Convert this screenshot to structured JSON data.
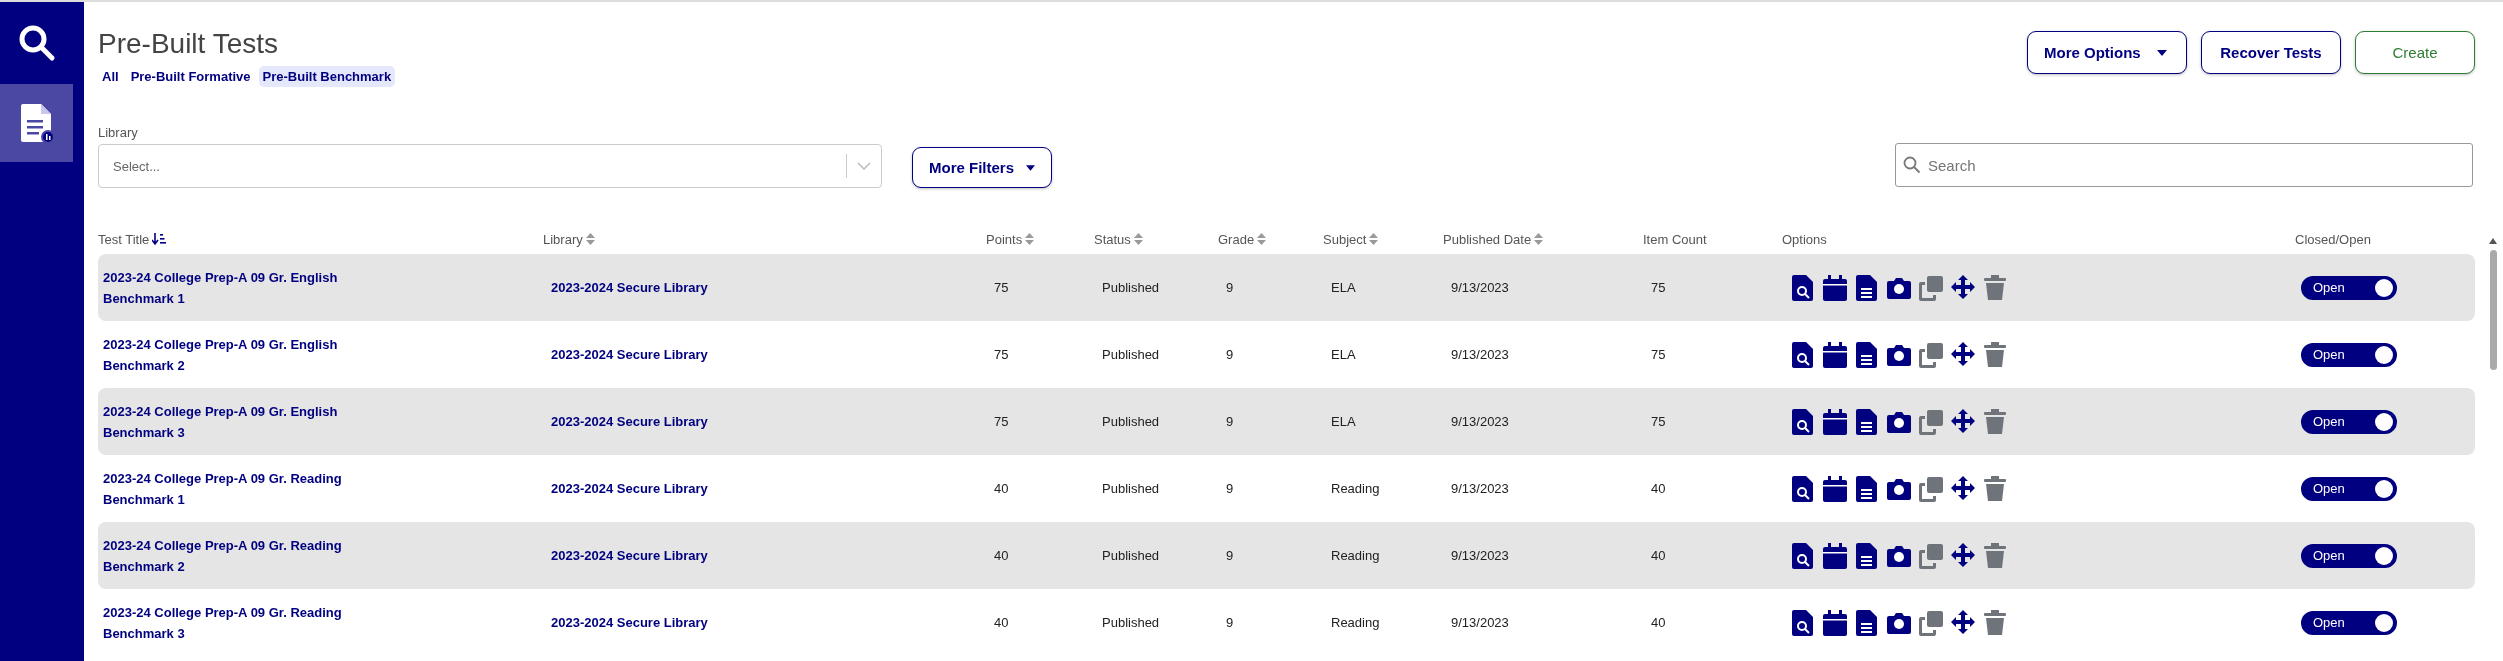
{
  "sidebar": {
    "items": [
      {
        "kind": "search",
        "selected": false
      },
      {
        "kind": "document",
        "selected": true
      }
    ]
  },
  "page": {
    "title": "Pre-Built Tests"
  },
  "tabs": [
    {
      "label": "All",
      "selected": false
    },
    {
      "label": "Pre-Built Formative",
      "selected": false
    },
    {
      "label": "Pre-Built Benchmark",
      "selected": true
    }
  ],
  "actions": [
    {
      "label": "More Options",
      "kind": "dropdown"
    },
    {
      "label": "Recover Tests",
      "kind": "outline"
    },
    {
      "label": "Create",
      "kind": "create"
    }
  ],
  "filters": {
    "library": {
      "label": "Library",
      "placeholder": "Select..."
    },
    "more_filters": "More Filters"
  },
  "search": {
    "placeholder": "Search"
  },
  "table": {
    "columns": [
      {
        "label": "Test Title",
        "kind": "sorted"
      },
      {
        "label": "Library",
        "kind": "sortable"
      },
      {
        "label": "Points",
        "kind": "sortable"
      },
      {
        "label": "Status",
        "kind": "sortable"
      },
      {
        "label": "Grade",
        "kind": "sortable"
      },
      {
        "label": "Subject",
        "kind": "sortable"
      },
      {
        "label": "Published Date",
        "kind": "sortable"
      },
      {
        "label": "Item Count",
        "kind": "plain"
      },
      {
        "label": "Options",
        "kind": "plain"
      },
      {
        "label": "Closed/Open",
        "kind": "plain"
      }
    ],
    "option_icons": [
      {
        "kind": "preview",
        "disabled": false
      },
      {
        "kind": "calendar",
        "disabled": false
      },
      {
        "kind": "document",
        "disabled": false
      },
      {
        "kind": "camera",
        "disabled": false
      },
      {
        "kind": "copy",
        "disabled": true
      },
      {
        "kind": "move",
        "disabled": false
      },
      {
        "kind": "trash",
        "disabled": true
      }
    ],
    "rows": [
      {
        "title": "2023-24 College Prep-A 09 Gr. English Benchmark 1",
        "library": "2023-2024 Secure Library",
        "points": "75",
        "status": "Published",
        "grade": "9",
        "subject": "ELA",
        "published_date": "9/13/2023",
        "item_count": "75",
        "open": true,
        "toggle_label": "Open"
      },
      {
        "title": "2023-24 College Prep-A 09 Gr. English Benchmark 2",
        "library": "2023-2024 Secure Library",
        "points": "75",
        "status": "Published",
        "grade": "9",
        "subject": "ELA",
        "published_date": "9/13/2023",
        "item_count": "75",
        "open": true,
        "toggle_label": "Open"
      },
      {
        "title": "2023-24 College Prep-A 09 Gr. English Benchmark 3",
        "library": "2023-2024 Secure Library",
        "points": "75",
        "status": "Published",
        "grade": "9",
        "subject": "ELA",
        "published_date": "9/13/2023",
        "item_count": "75",
        "open": true,
        "toggle_label": "Open"
      },
      {
        "title": "2023-24 College Prep-A 09 Gr. Reading Benchmark 1",
        "library": "2023-2024 Secure Library",
        "points": "40",
        "status": "Published",
        "grade": "9",
        "subject": "Reading",
        "published_date": "9/13/2023",
        "item_count": "40",
        "open": true,
        "toggle_label": "Open"
      },
      {
        "title": "2023-24 College Prep-A 09 Gr. Reading Benchmark 2",
        "library": "2023-2024 Secure Library",
        "points": "40",
        "status": "Published",
        "grade": "9",
        "subject": "Reading",
        "published_date": "9/13/2023",
        "item_count": "40",
        "open": true,
        "toggle_label": "Open"
      },
      {
        "title": "2023-24 College Prep-A 09 Gr. Reading Benchmark 3",
        "library": "2023-2024 Secure Library",
        "points": "40",
        "status": "Published",
        "grade": "9",
        "subject": "Reading",
        "published_date": "9/13/2023",
        "item_count": "40",
        "open": true,
        "toggle_label": "Open"
      }
    ]
  }
}
